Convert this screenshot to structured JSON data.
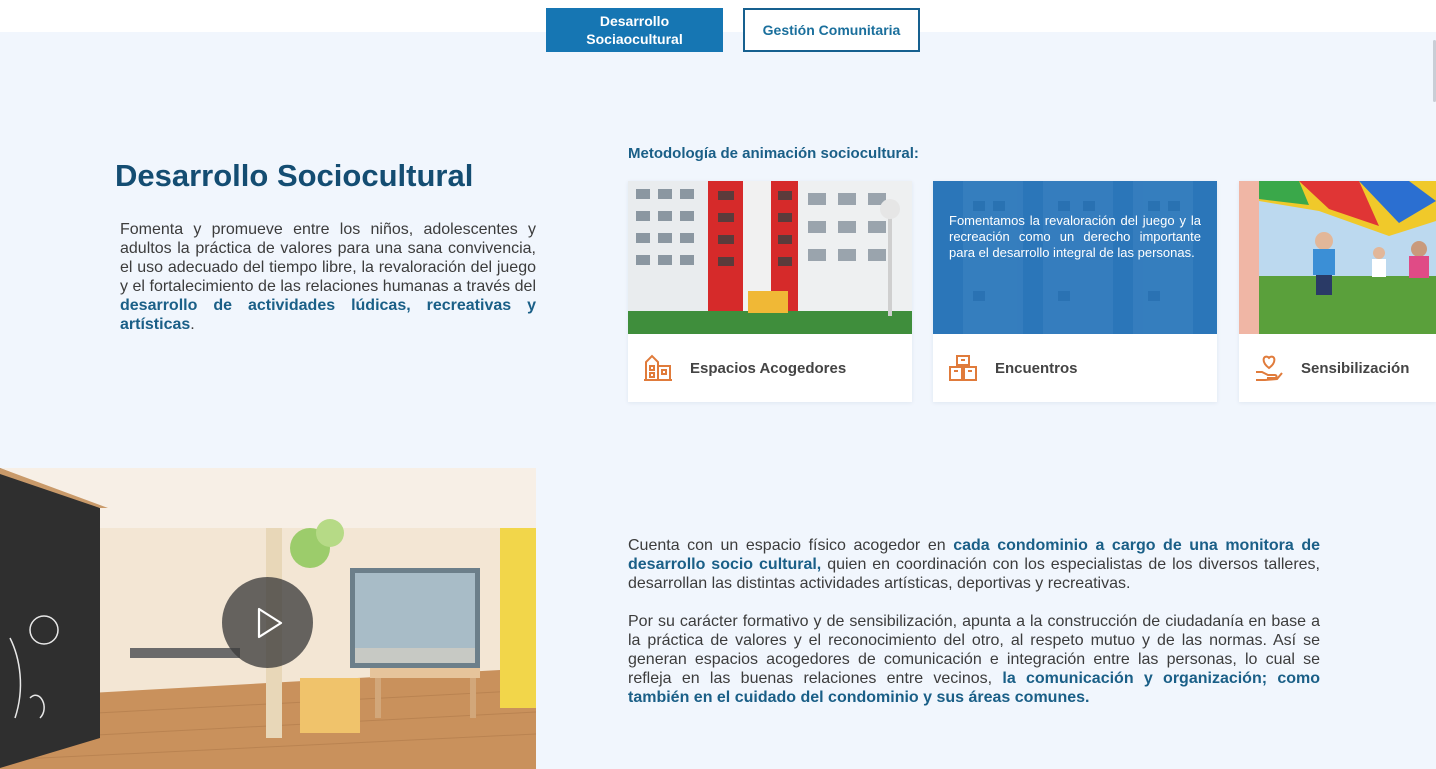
{
  "tabs": {
    "active_label": "Desarrollo Sociaocultural",
    "inactive_label": "Gestión Comunitaria"
  },
  "section": {
    "title": "Desarrollo Sociocultural",
    "intro_plain": "Fomenta y promueve entre los niños, adolescentes y adultos la práctica de valores para una sana convivencia, el uso adecuado del tiempo libre, la revaloración del juego y el fortalecimiento de las relaciones humanas a través del ",
    "intro_highlight": "desarrollo de actividades lúdicas, recreativas y artísticas",
    "intro_end": "."
  },
  "methodology": {
    "title": "Metodología de animación sociocultural:",
    "cards": [
      {
        "label": "Espacios Acogedores",
        "icon": "building-icon"
      },
      {
        "label": "Encuentros",
        "icon": "group-blocks-icon",
        "overlay_text": "Fomentamos la revaloración del juego y la recreación como un derecho importante para el desarrollo integral de las personas."
      },
      {
        "label": "Sensibilización",
        "icon": "heart-hand-icon"
      }
    ]
  },
  "details": {
    "p1_a": "Cuenta con un espacio físico acogedor en ",
    "p1_hl": "cada condominio a cargo de una monitora de desarrollo socio cultural,",
    "p1_b": " quien en coordinación con los especialistas de los diversos talleres, desarrollan las distintas actividades artísticas, deportivas y recreativas.",
    "p2_a": "Por su carácter formativo y de sensibilización, apunta a la construcción de ciudadanía en base a la práctica de valores y el reconocimiento del otro, al respeto mutuo y de las normas. Así se generan espacios acogedores de comunicación e integración entre las personas, lo cual se refleja en las buenas relaciones entre vecinos, ",
    "p2_hl": "la comunicación y organización; como también en el cuidado del condominio y sus áreas comunes."
  },
  "colors": {
    "accent": "#1676b3",
    "heading": "#144d72",
    "highlight": "#1a5f87",
    "icon_orange": "#e07b3b",
    "background": "#f1f6fd"
  }
}
